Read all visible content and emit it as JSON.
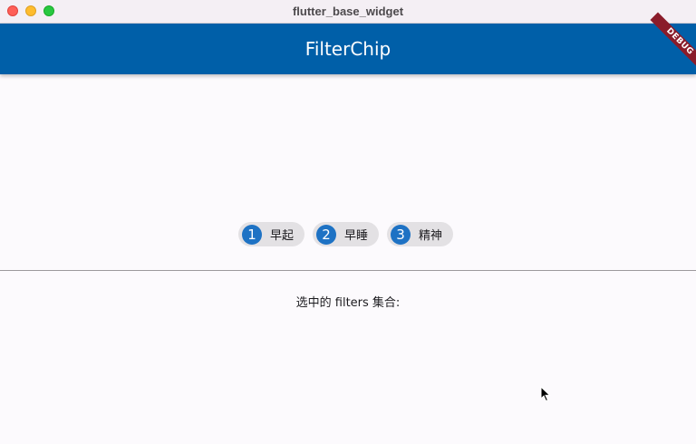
{
  "window": {
    "title": "flutter_base_widget"
  },
  "appbar": {
    "title": "FilterChip",
    "debug_banner": "DEBUG"
  },
  "chips": [
    {
      "avatar": "1",
      "label": "早起"
    },
    {
      "avatar": "2",
      "label": "早睡"
    },
    {
      "avatar": "3",
      "label": "精神"
    }
  ],
  "selection": {
    "text": "选中的 filters 集合:"
  },
  "colors": {
    "appbar": "#005fa8",
    "chip_avatar": "#1e72c4",
    "chip_background": "#e3e1e4",
    "debug_banner": "#8a1c2a"
  }
}
